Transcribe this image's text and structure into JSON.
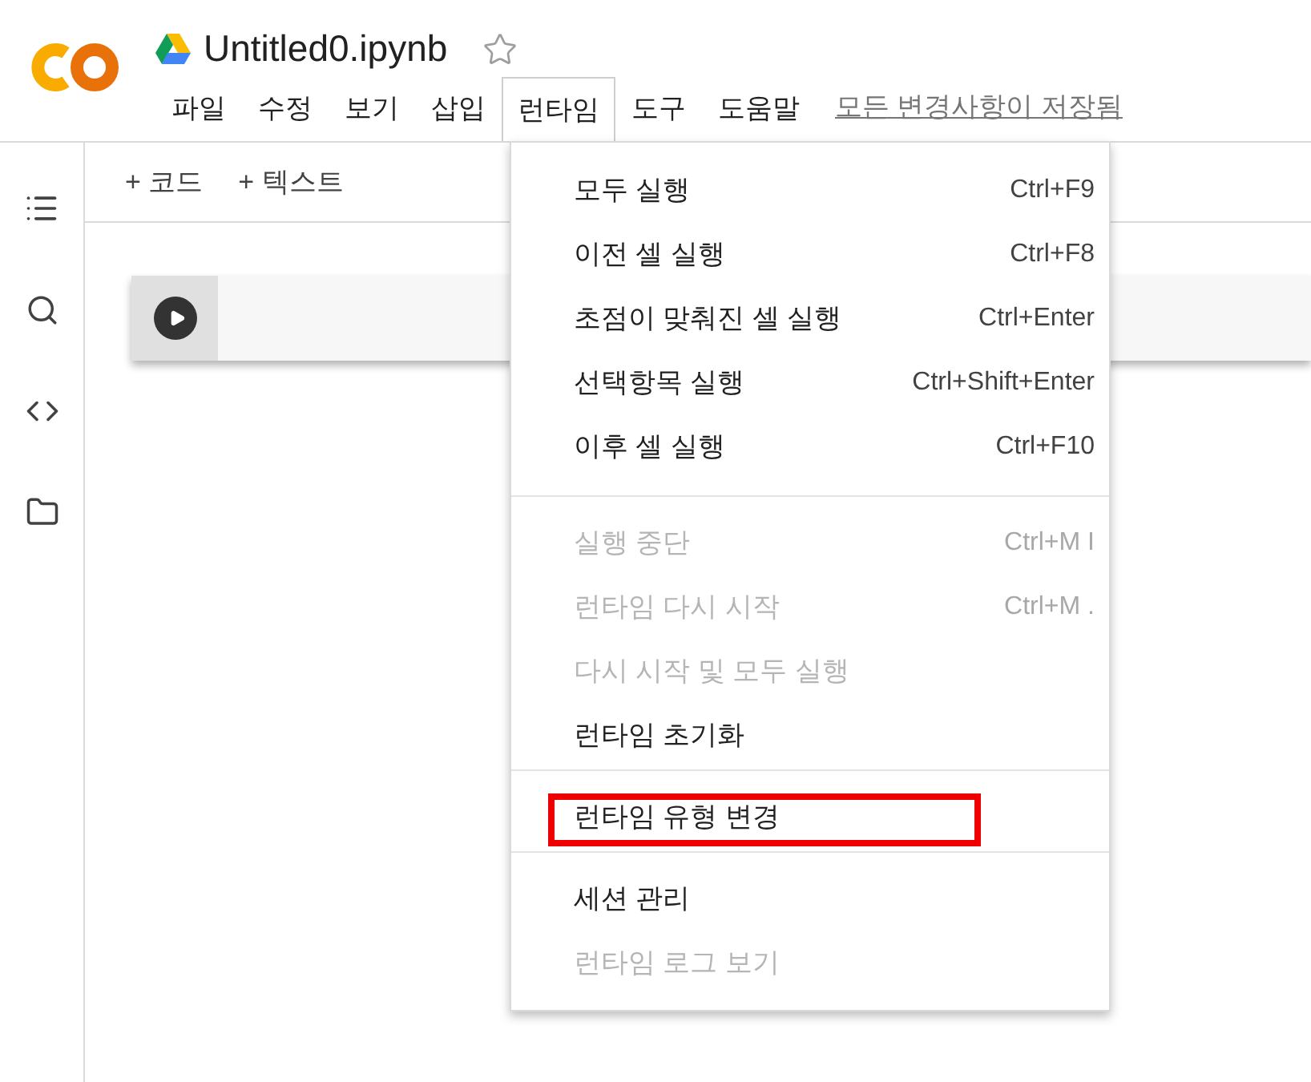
{
  "notebook": {
    "title": "Untitled0.ipynb",
    "starred": false
  },
  "menu_bar": [
    {
      "label": "파일",
      "selected": false
    },
    {
      "label": "수정",
      "selected": false
    },
    {
      "label": "보기",
      "selected": false
    },
    {
      "label": "삽입",
      "selected": false
    },
    {
      "label": "런타임",
      "selected": true
    },
    {
      "label": "도구",
      "selected": false
    },
    {
      "label": "도움말",
      "selected": false
    }
  ],
  "save_status": "모든 변경사항이 저장됨",
  "toolbar": [
    "+ 코드",
    "+ 텍스트"
  ],
  "dropdown_menu": [
    [
      {
        "label": "모두 실행",
        "shortcut": "Ctrl+F9",
        "disabled": false,
        "highlighted": false
      },
      {
        "label": "이전 셀 실행",
        "shortcut": "Ctrl+F8",
        "disabled": false,
        "highlighted": false
      },
      {
        "label": "초점이 맞춰진 셀 실행",
        "shortcut": "Ctrl+Enter",
        "disabled": false,
        "highlighted": false
      },
      {
        "label": "선택항목 실행",
        "shortcut": "Ctrl+Shift+Enter",
        "disabled": false,
        "highlighted": false
      },
      {
        "label": "이후 셀 실행",
        "shortcut": "Ctrl+F10",
        "disabled": false,
        "highlighted": false
      }
    ],
    [
      {
        "label": "실행 중단",
        "shortcut": "Ctrl+M I",
        "disabled": true,
        "highlighted": false
      },
      {
        "label": "런타임 다시 시작",
        "shortcut": "Ctrl+M .",
        "disabled": true,
        "highlighted": false
      },
      {
        "label": "다시 시작 및 모두 실행",
        "disabled": true,
        "highlighted": false
      },
      {
        "label": "런타임 초기화",
        "disabled": false,
        "highlighted": false
      }
    ],
    [
      {
        "label": "런타임 유형 변경",
        "disabled": false,
        "highlighted": true
      }
    ],
    [
      {
        "label": "세션 관리",
        "disabled": false,
        "highlighted": false
      },
      {
        "label": "런타임 로그 보기",
        "disabled": true,
        "highlighted": false
      }
    ]
  ]
}
